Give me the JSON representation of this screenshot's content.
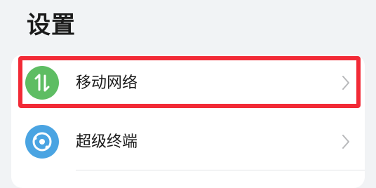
{
  "page": {
    "title": "设置"
  },
  "settings": {
    "items": [
      {
        "label": "移动网络",
        "icon": "mobile-data-icon",
        "icon_color": "#5ebd63"
      },
      {
        "label": "超级终端",
        "icon": "super-device-icon",
        "icon_color": "#4aa4e2"
      }
    ]
  },
  "colors": {
    "background": "#f1f3f5",
    "card": "#ffffff",
    "highlight": "#f22a36"
  }
}
